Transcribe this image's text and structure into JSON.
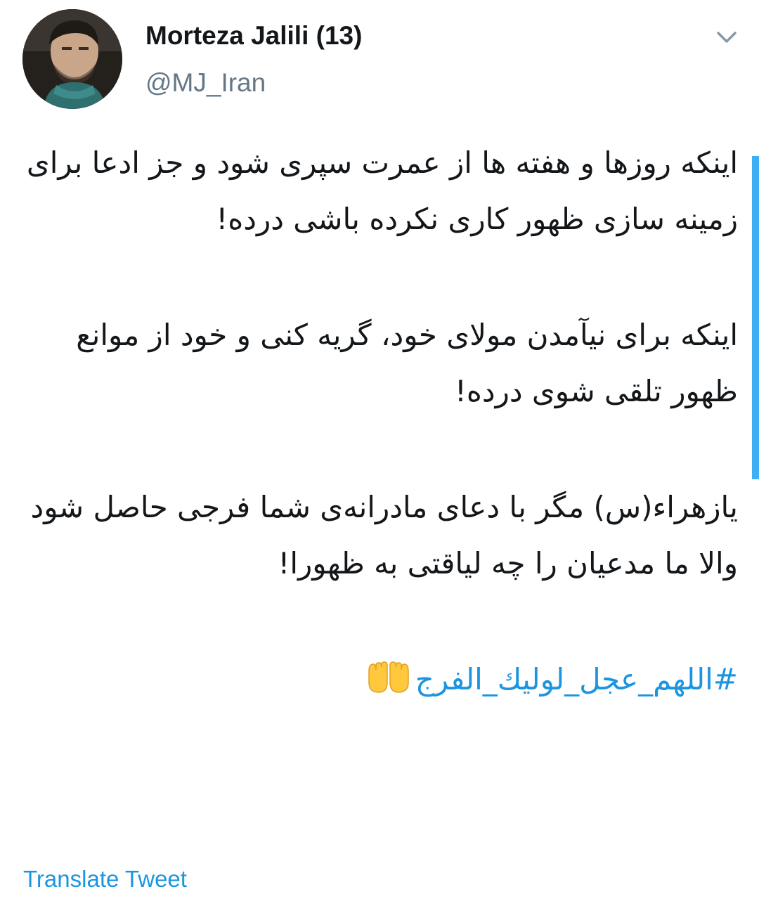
{
  "author": {
    "display_name": "Morteza Jalili (13)",
    "handle": "@MJ_Iran",
    "avatar_icon": "profile-photo"
  },
  "menu": {
    "icon": "chevron-down-icon"
  },
  "tweet": {
    "paragraphs": [
      "اینکه روزها و هفته ها از عمرت سپری شود و جز ادعا برای زمینه سازی ظهور کاری نکرده باشی درده!",
      "اینکه برای نیآمدن مولای خود، گریه کنی و خود از موانع ظهور تلقی شوی درده!",
      "یازهراء(س) مگر با دعای مادرانه‌ی شما فرجی حاصل شود والا ما مدعیان را چه لیاقتی به ظهورا!"
    ],
    "hashtag": "#اللهم_عجل_لوليك_الفرج",
    "emoji_icon": "palms-up-together-icon"
  },
  "actions": {
    "translate_label": "Translate Tweet"
  },
  "colors": {
    "link": "#1b95e0",
    "text": "#14171a",
    "secondary": "#657786"
  }
}
